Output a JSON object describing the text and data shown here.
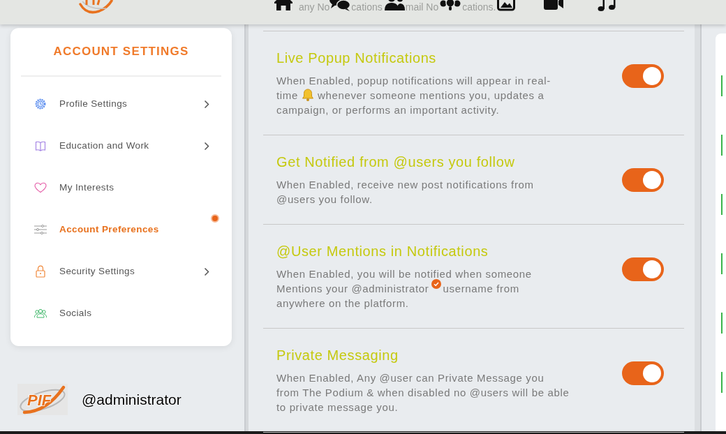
{
  "header": {
    "underlying_texts": [
      "any No",
      "cations",
      "mail No",
      "cations."
    ]
  },
  "sidebar": {
    "title": "ACCOUNT SETTINGS",
    "items": [
      {
        "label": "Profile Settings",
        "selected": false,
        "submenu": true,
        "alert": false
      },
      {
        "label": "Education and Work",
        "selected": false,
        "submenu": true,
        "alert": false
      },
      {
        "label": "My Interests",
        "selected": false,
        "submenu": false,
        "alert": false
      },
      {
        "label": "Account Preferences",
        "selected": true,
        "submenu": false,
        "alert": true
      },
      {
        "label": "Security Settings",
        "selected": false,
        "submenu": true,
        "alert": false
      },
      {
        "label": "Socials",
        "selected": false,
        "submenu": false,
        "alert": false
      }
    ]
  },
  "user": {
    "logo_text": "PIF",
    "username": "@administrator"
  },
  "settings": [
    {
      "title": "Live Popup Notifications",
      "description": [
        "When Enabled, popup notifications will appear in real-time",
        "whenever someone mentions you, updates a campaign, or performs an important activity."
      ],
      "on": true
    },
    {
      "title": "Get Notified from @users you follow",
      "description": [
        "When Enabled, receive new post notifications from @users you follow."
      ],
      "on": true
    },
    {
      "title": "@User Mentions in Notifications",
      "description": [
        "When Enabled, you will be notified when someone Mentions your @administrator",
        "username from anywhere on the platform."
      ],
      "on": true
    },
    {
      "title": "Private Messaging",
      "description": [
        "When Enabled, Any @user can Private Message you from The Podium & when disabled no @users will be able to private message you."
      ],
      "on": true
    }
  ]
}
